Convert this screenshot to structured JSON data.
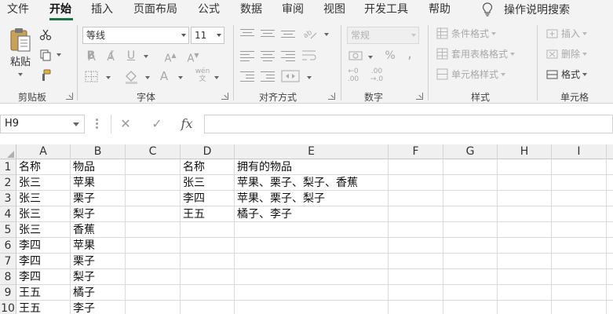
{
  "ribbon_tabs": [
    "文件",
    "开始",
    "插入",
    "页面布局",
    "公式",
    "数据",
    "审阅",
    "视图",
    "开发工具",
    "帮助"
  ],
  "active_tab": "开始",
  "tell_me": "操作说明搜索",
  "clipboard": {
    "paste_label": "粘贴",
    "group_label": "剪贴板"
  },
  "font": {
    "name": "等线",
    "size": "11",
    "group_label": "字体"
  },
  "alignment": {
    "group_label": "对齐方式"
  },
  "number": {
    "format": "常规",
    "group_label": "数字"
  },
  "styles": {
    "conditional": "条件格式",
    "table": "套用表格格式",
    "cell": "单元格样式",
    "group_label": "样式"
  },
  "cells": {
    "insert": "插入",
    "delete": "删除",
    "format": "格式",
    "group_label": "单元格"
  },
  "formula_bar": {
    "name_box": "H9",
    "cancel": "✕",
    "enter": "✓",
    "fx": "fx",
    "formula": ""
  },
  "accent_color": "#1e7145",
  "sheet": {
    "columns": [
      "A",
      "B",
      "C",
      "D",
      "E",
      "F",
      "G",
      "H",
      "I"
    ],
    "rows": [
      "1",
      "2",
      "3",
      "4",
      "5",
      "6",
      "7",
      "8",
      "9",
      "10"
    ],
    "table1": [
      [
        "名称",
        "物品"
      ],
      [
        "张三",
        "苹果"
      ],
      [
        "张三",
        "栗子"
      ],
      [
        "张三",
        "梨子"
      ],
      [
        "张三",
        "香蕉"
      ],
      [
        "李四",
        "苹果"
      ],
      [
        "李四",
        "栗子"
      ],
      [
        "李四",
        "梨子"
      ],
      [
        "王五",
        "橘子"
      ],
      [
        "王五",
        "李子"
      ]
    ],
    "table2": [
      [
        "名称",
        "拥有的物品"
      ],
      [
        "张三",
        "苹果、栗子、梨子、香蕉"
      ],
      [
        "李四",
        "苹果、栗子、梨子"
      ],
      [
        "王五",
        "橘子、李子"
      ]
    ]
  }
}
